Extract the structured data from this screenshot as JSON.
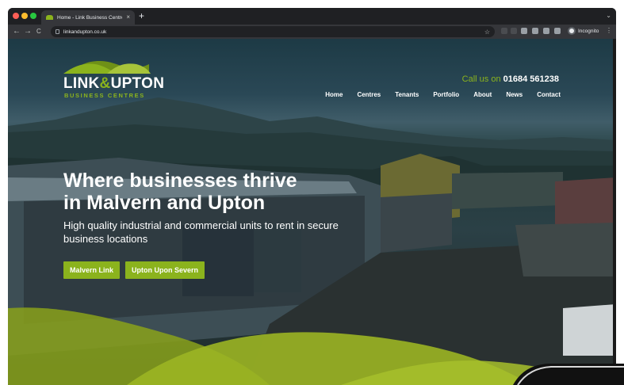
{
  "browser": {
    "tab": {
      "title": "Home - Link Business Centre",
      "close": "×"
    },
    "new_tab": "+",
    "tab_menu": "⌄",
    "back": "←",
    "forward": "→",
    "reload": "C",
    "url": "linkandupton.co.uk",
    "bookmark": "☆",
    "profile_label": "Incognito",
    "menu": "⋮"
  },
  "site": {
    "logo": {
      "part1": "LINK",
      "amp": "&",
      "part2": "UPTON",
      "subtitle": "BUSINESS CENTRES"
    },
    "phone": {
      "prefix": "Call us on",
      "number": "01684 561238"
    },
    "nav": [
      "Home",
      "Centres",
      "Tenants",
      "Portfolio",
      "About",
      "News",
      "Contact"
    ],
    "hero": {
      "title_line1": "Where businesses thrive",
      "title_line2": "in Malvern and Upton",
      "subtitle": "High quality industrial and commercial units to rent in secure business locations"
    },
    "buttons": [
      "Malvern Link",
      "Upton Upon Severn"
    ]
  },
  "colors": {
    "accent": "#8bb31d",
    "chrome": "#1f2023",
    "toolbar": "#35363a"
  }
}
